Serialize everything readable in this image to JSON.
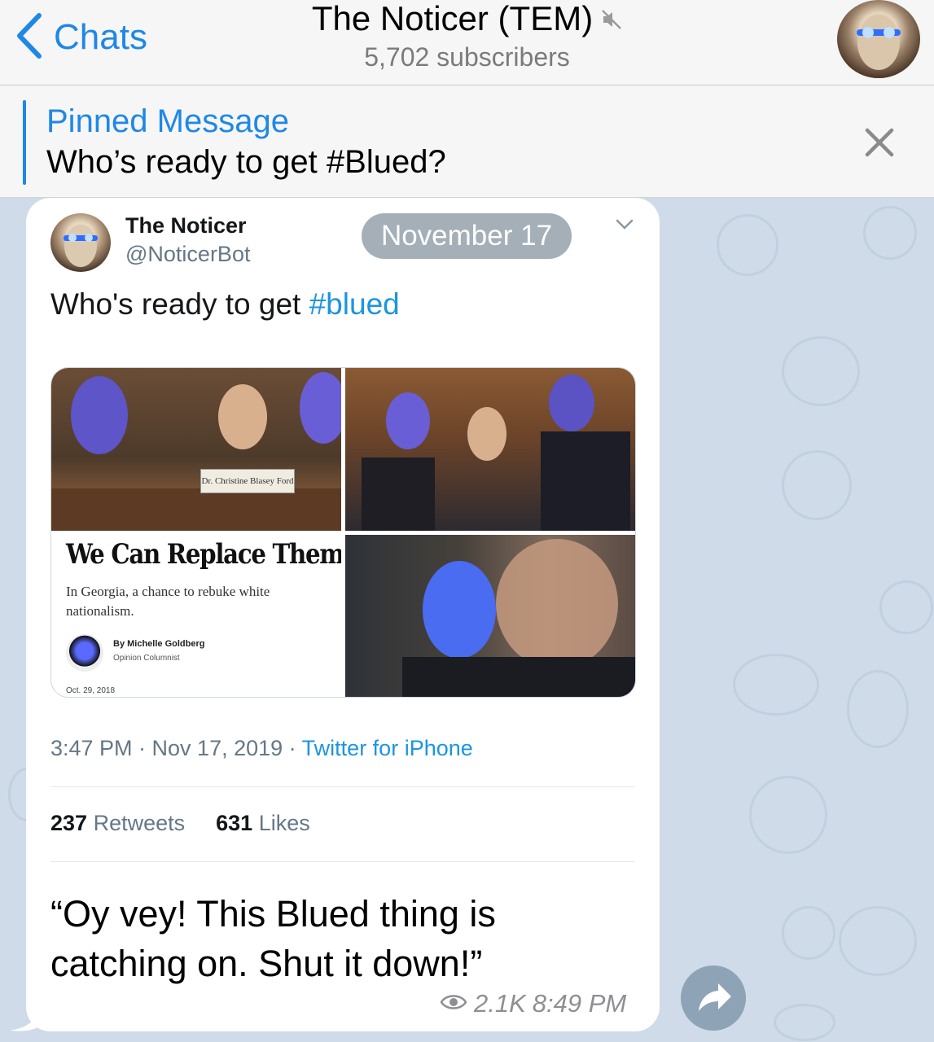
{
  "header": {
    "back_label": "Chats",
    "title": "The Noticer (TEM)",
    "subtitle": "5,702 subscribers"
  },
  "pinned": {
    "label": "Pinned Message",
    "text": "Who’s ready to get #Blued?"
  },
  "tweet": {
    "name": "The Noticer",
    "handle": "@NoticerBot",
    "date_pill": "November 17",
    "text_prefix": "Who's ready to get ",
    "hashtag": "#blued",
    "media": {
      "nameplate": "Dr. Christine Blasey Ford",
      "headline": "We Can Replace Them",
      "subhead": "In Georgia, a chance to rebuke white nationalism.",
      "byline": "By Michelle Goldberg",
      "role": "Opinion Columnist",
      "date": "Oct. 29, 2018"
    },
    "time": "3:47 PM · Nov 17, 2019 · ",
    "source": "Twitter for iPhone",
    "retweets_count": "237",
    "retweets_label": "Retweets",
    "likes_count": "631",
    "likes_label": "Likes"
  },
  "message": {
    "caption": "“Oy vey! This Blued thing is catching on. Shut it down!”",
    "views": "2.1K",
    "time": "8:49 PM"
  },
  "colors": {
    "accent": "#1f88e5",
    "twitter_blue": "#1b95e0",
    "chat_bg": "#cfdbe8"
  },
  "icons": [
    "chevron-left-icon",
    "muted-speaker-icon",
    "close-icon",
    "chevron-down-icon",
    "eye-icon",
    "share-arrow-icon"
  ]
}
